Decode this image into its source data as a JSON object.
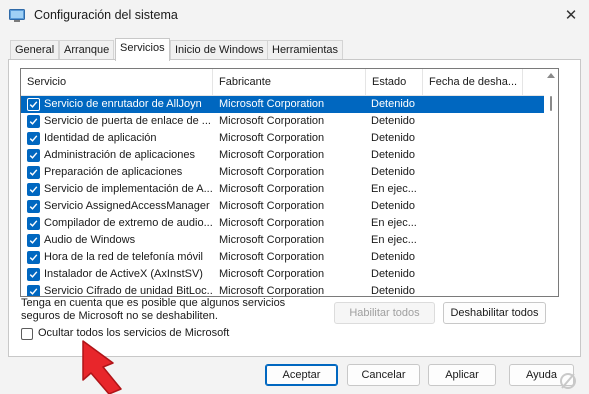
{
  "window": {
    "title": "Configuración del sistema",
    "close_glyph": "✕"
  },
  "tabs": [
    {
      "label": "General"
    },
    {
      "label": "Arranque"
    },
    {
      "label": "Servicios"
    },
    {
      "label": "Inicio de Windows"
    },
    {
      "label": "Herramientas"
    }
  ],
  "services": {
    "columns": [
      "Servicio",
      "Fabricante",
      "Estado",
      "Fecha de desha..."
    ],
    "rows": [
      {
        "name": "Servicio de enrutador de AllJoyn",
        "maker": "Microsoft Corporation",
        "status": "Detenido"
      },
      {
        "name": "Servicio de puerta de enlace de ...",
        "maker": "Microsoft Corporation",
        "status": "Detenido"
      },
      {
        "name": "Identidad de aplicación",
        "maker": "Microsoft Corporation",
        "status": "Detenido"
      },
      {
        "name": "Administración de aplicaciones",
        "maker": "Microsoft Corporation",
        "status": "Detenido"
      },
      {
        "name": "Preparación de aplicaciones",
        "maker": "Microsoft Corporation",
        "status": "Detenido"
      },
      {
        "name": "Servicio de implementación de A...",
        "maker": "Microsoft Corporation",
        "status": "En ejec..."
      },
      {
        "name": "Servicio AssignedAccessManager",
        "maker": "Microsoft Corporation",
        "status": "Detenido"
      },
      {
        "name": "Compilador de extremo de audio...",
        "maker": "Microsoft Corporation",
        "status": "En ejec..."
      },
      {
        "name": "Audio de Windows",
        "maker": "Microsoft Corporation",
        "status": "En ejec..."
      },
      {
        "name": "Hora de la red de telefonía móvil",
        "maker": "Microsoft Corporation",
        "status": "Detenido"
      },
      {
        "name": "Instalador de ActiveX (AxInstSV)",
        "maker": "Microsoft Corporation",
        "status": "Detenido"
      },
      {
        "name": "Servicio Cifrado de unidad BitLoc...",
        "maker": "Microsoft Corporation",
        "status": "Detenido"
      }
    ]
  },
  "note": {
    "line1": "Tenga en cuenta que es posible que algunos servicios",
    "line2": "seguros de Microsoft no se deshabiliten."
  },
  "buttons": {
    "enable_all": "Habilitar todos",
    "disable_all": "Deshabilitar todos",
    "ok": "Aceptar",
    "cancel": "Cancelar",
    "apply": "Aplicar",
    "help": "Ayuda"
  },
  "hide_ms": {
    "label": "Ocultar todos los servicios de Microsoft",
    "checked": false
  },
  "colors": {
    "accent": "#0067c0",
    "arrow": "#e8262b",
    "watermark": "#c9c9c9"
  },
  "icons": [
    "app-icon",
    "close-icon",
    "checkbox-checked-icon",
    "scroll-up-icon",
    "red-arrow-annotation"
  ]
}
